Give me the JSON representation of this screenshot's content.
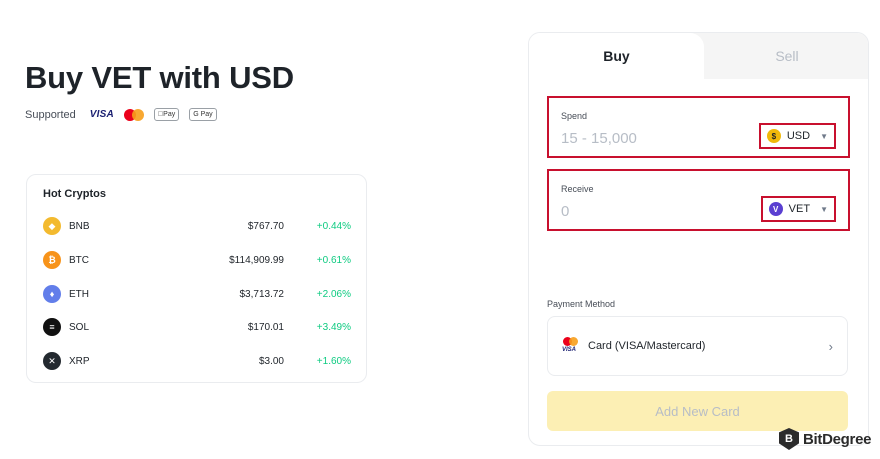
{
  "page": {
    "title": "Buy VET with USD"
  },
  "supported": {
    "label": "Supported",
    "visa": "VISA",
    "applepay": "Pay",
    "googlepay": "G Pay"
  },
  "hot": {
    "title": "Hot Cryptos",
    "coins": [
      {
        "symbol": "BNB",
        "price": "$767.70",
        "change": "+0.44%",
        "color": "#f3ba2f",
        "icon": "bnb-icon",
        "glyph": "◆"
      },
      {
        "symbol": "BTC",
        "price": "$114,909.99",
        "change": "+0.61%",
        "color": "#f7931a",
        "icon": "btc-icon",
        "glyph": "₿"
      },
      {
        "symbol": "ETH",
        "price": "$3,713.72",
        "change": "+2.06%",
        "color": "#627eea",
        "icon": "eth-icon",
        "glyph": "♦"
      },
      {
        "symbol": "SOL",
        "price": "$170.01",
        "change": "+3.49%",
        "color": "#111111",
        "icon": "sol-icon",
        "glyph": "≡"
      },
      {
        "symbol": "XRP",
        "price": "$3.00",
        "change": "+1.60%",
        "color": "#23292f",
        "icon": "xrp-icon",
        "glyph": "✕"
      }
    ]
  },
  "trade": {
    "tabs": {
      "buy": "Buy",
      "sell": "Sell"
    },
    "spend": {
      "label": "Spend",
      "placeholder": "15 - 15,000",
      "currency": "USD",
      "currency_icon": "$",
      "currency_color": "#f0b90b"
    },
    "receive": {
      "label": "Receive",
      "value": "0",
      "currency": "VET",
      "currency_icon": "V",
      "currency_color": "#5a3fd1"
    },
    "payment": {
      "label": "Payment Method",
      "method": "Card (VISA/Mastercard)",
      "visa_mark": "VISA"
    },
    "add_card": "Add New Card"
  },
  "watermark": {
    "brand": "BitDegree",
    "icon_letter": "B"
  },
  "colors": {
    "positive": "#0ecb81",
    "highlight_border": "#c8102e",
    "add_card_bg": "#fcefb4"
  }
}
